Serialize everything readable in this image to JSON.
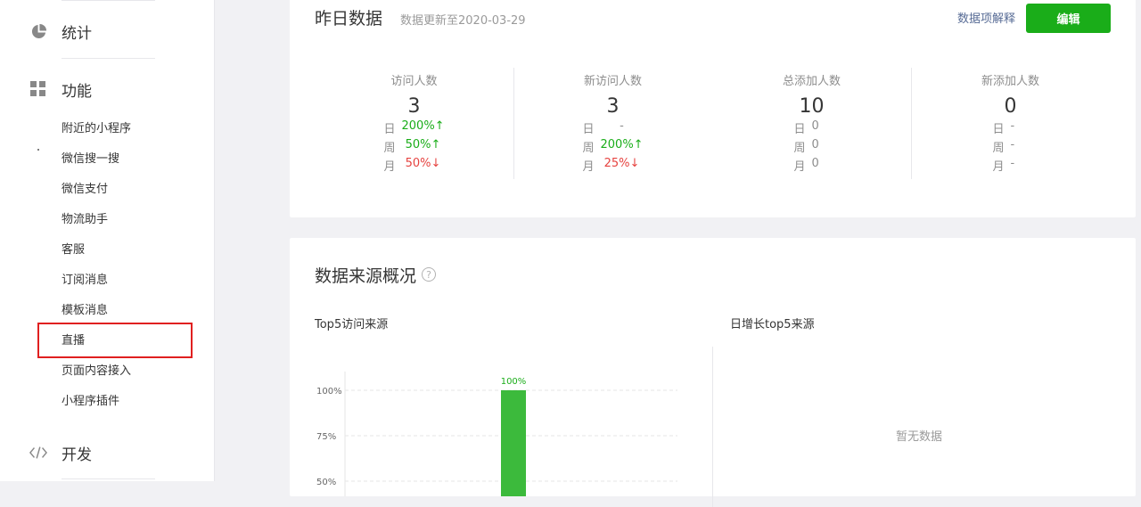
{
  "sidebar": {
    "stats_label": "统计",
    "features_label": "功能",
    "dev_label": "开发",
    "items": [
      "附近的小程序",
      "微信搜一搜",
      "微信支付",
      "物流助手",
      "客服",
      "订阅消息",
      "模板消息",
      "直播",
      "页面内容接入",
      "小程序插件"
    ]
  },
  "yesterday": {
    "title": "昨日数据",
    "updated": "数据更新至2020-03-29",
    "explain_link": "数据项解释",
    "edit_button": "编辑",
    "row_labels": {
      "day": "日",
      "week": "周",
      "month": "月"
    },
    "stats": [
      {
        "name": "访问人数",
        "value": "3",
        "day": "200%↑",
        "week": "50%↑",
        "month": "50%↓",
        "day_state": "up",
        "week_state": "up",
        "month_state": "down"
      },
      {
        "name": "新访问人数",
        "value": "3",
        "day": "-",
        "week": "200%↑",
        "month": "25%↓",
        "day_state": "flat",
        "week_state": "up",
        "month_state": "down"
      },
      {
        "name": "总添加人数",
        "value": "10",
        "day": "0",
        "week": "0",
        "month": "0",
        "day_state": "flat",
        "week_state": "flat",
        "month_state": "flat"
      },
      {
        "name": "新添加人数",
        "value": "0",
        "day": "-",
        "week": "-",
        "month": "-",
        "day_state": "flat",
        "week_state": "flat",
        "month_state": "flat"
      }
    ]
  },
  "source": {
    "title": "数据来源概况",
    "top5_label": "Top5访问来源",
    "growth_label": "日增长top5来源",
    "empty_text": "暂无数据"
  },
  "chart_data": {
    "type": "bar",
    "categories": [
      ""
    ],
    "values": [
      100
    ],
    "value_labels": [
      "100%"
    ],
    "y_ticks": [
      "100%",
      "75%",
      "50%"
    ],
    "ylim": [
      0,
      100
    ],
    "grid": true,
    "bar_color": "#3cba3c",
    "label_color": "#1aad19"
  },
  "colors": {
    "accent": "#1aad19",
    "up": "#1aad19",
    "down": "#e64340",
    "link": "#576b95"
  }
}
